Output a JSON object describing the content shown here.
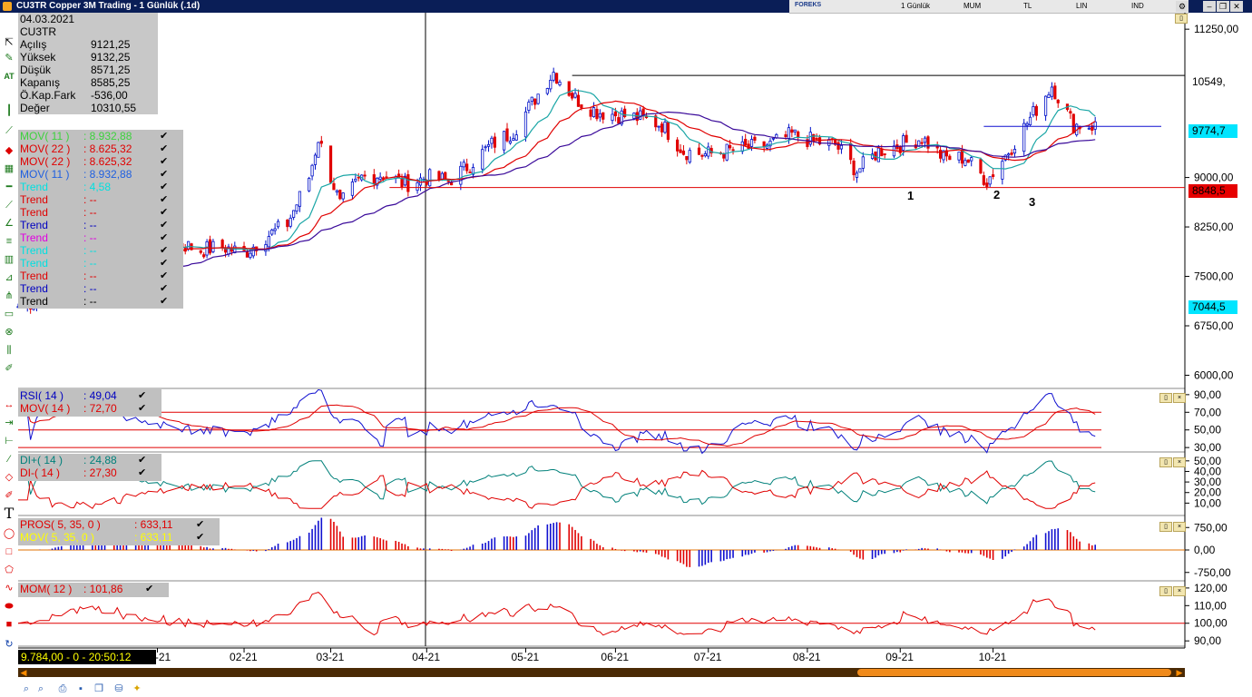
{
  "window": {
    "title": "CU3TR Copper 3M Trading - 1 Günlük (.1d)",
    "brand": "FOREKS",
    "options": [
      "1 Günlük",
      "MUM",
      "TL",
      "LIN",
      "IND"
    ]
  },
  "info": {
    "date": "04.03.2021",
    "symbol": "CU3TR",
    "rows": [
      {
        "label": "Açılış",
        "value": "9121,25"
      },
      {
        "label": "Yüksek",
        "value": "9132,25"
      },
      {
        "label": "Düşük",
        "value": "8571,25"
      },
      {
        "label": "Kapanış",
        "value": "8585,25"
      },
      {
        "label": "Ö.Kap.Fark",
        "value": "-536,00"
      },
      {
        "label": "Değer",
        "value": "10310,55"
      }
    ]
  },
  "price_legend": [
    {
      "name": "MOV( 11 )",
      "value": ": 8.932,88",
      "color": "#3cd23c"
    },
    {
      "name": "MOV( 22 )",
      "value": ": 8.625,32",
      "color": "#e00000"
    },
    {
      "name": "MOV( 22 )",
      "value": ": 8.625,32",
      "color": "#e00000"
    },
    {
      "name": "MOV( 11 )",
      "value": ": 8.932,88",
      "color": "#2060e0"
    },
    {
      "name": "Trend",
      "value": ": 4,58",
      "color": "#00e0e0"
    },
    {
      "name": "Trend",
      "value": ": --",
      "color": "#e00000"
    },
    {
      "name": "Trend",
      "value": ": --",
      "color": "#e00000"
    },
    {
      "name": "Trend",
      "value": ": --",
      "color": "#0000c0"
    },
    {
      "name": "Trend",
      "value": ": --",
      "color": "#e000e0"
    },
    {
      "name": "Trend",
      "value": ": --",
      "color": "#00e0e0"
    },
    {
      "name": "Trend",
      "value": ": --",
      "color": "#00e0e0"
    },
    {
      "name": "Trend",
      "value": ": --",
      "color": "#e00000"
    },
    {
      "name": "Trend",
      "value": ": --",
      "color": "#0000c0"
    },
    {
      "name": "Trend",
      "value": ": --",
      "color": "#000000"
    }
  ],
  "rsi_legend": [
    {
      "name": "RSI( 14 )",
      "value": ": 49,04",
      "color": "#0000c0"
    },
    {
      "name": "MOV( 14 )",
      "value": ": 72,70",
      "color": "#e00000"
    }
  ],
  "di_legend": [
    {
      "name": "DI+( 14 )",
      "value": ": 24,88",
      "color": "#00807a"
    },
    {
      "name": "DI-( 14 )",
      "value": ": 27,30",
      "color": "#e00000"
    }
  ],
  "pros_legend": [
    {
      "name": "PROS( 5, 35, 0 )",
      "value": ": 633,11",
      "color": "#e00000"
    },
    {
      "name": "MOV( 5, 35, 0 )",
      "value": ": 633,11",
      "color": "#ffff00"
    }
  ],
  "mom_legend": [
    {
      "name": "MOM( 12 )",
      "value": ": 101,86",
      "color": "#e00000"
    }
  ],
  "price_labels": [
    {
      "text": "10549,",
      "bg": "#ffffff",
      "fg": "#000000"
    },
    {
      "text": "9774,7",
      "bg": "#00e5ff",
      "fg": "#000000"
    },
    {
      "text": "8848,5",
      "bg": "#e60000",
      "fg": "#000000"
    },
    {
      "text": "7044,5",
      "bg": "#00e5ff",
      "fg": "#000000"
    }
  ],
  "pattern_marks": [
    "1",
    "2",
    "3"
  ],
  "status": "9.784,00 - 0 - 20:50:12",
  "chart_data": [
    {
      "type": "candlestick",
      "title": "CU3TR Copper 3M Trading - 1 Günlük (.1d)",
      "x_ticks": [
        "01-21",
        "02-21",
        "03-21",
        "04-21",
        "05-21",
        "06-21",
        "07-21",
        "08-21",
        "09-21",
        "10-21"
      ],
      "y_ticks": [
        "11250,00",
        "10500,00",
        "9750,00",
        "9000,00",
        "8250,00",
        "7500,00",
        "6750,00",
        "6000,00"
      ],
      "ylim": [
        5800,
        11500
      ],
      "horizontal_levels": [
        10549,
        9774.7,
        8848.5
      ],
      "close_path": [
        [
          "2020-11-20",
          7044
        ],
        [
          "2020-11-27",
          7150
        ],
        [
          "2020-12-04",
          7400
        ],
        [
          "2020-12-11",
          7700
        ],
        [
          "2020-12-18",
          7850
        ],
        [
          "2020-12-25",
          7900
        ],
        [
          "2021-01-04",
          7950
        ],
        [
          "2021-01-11",
          8000
        ],
        [
          "2021-01-18",
          7900
        ],
        [
          "2021-01-25",
          7950
        ],
        [
          "2021-02-01",
          7850
        ],
        [
          "2021-02-08",
          8100
        ],
        [
          "2021-02-15",
          8300
        ],
        [
          "2021-02-22",
          9000
        ],
        [
          "2021-02-25",
          9600
        ],
        [
          "2021-03-04",
          8585
        ],
        [
          "2021-03-11",
          9000
        ],
        [
          "2021-03-18",
          9050
        ],
        [
          "2021-03-25",
          8900
        ],
        [
          "2021-04-01",
          9000
        ],
        [
          "2021-04-08",
          8950
        ],
        [
          "2021-04-15",
          9200
        ],
        [
          "2021-04-22",
          9500
        ],
        [
          "2021-04-29",
          9700
        ],
        [
          "2021-05-06",
          10200
        ],
        [
          "2021-05-12",
          10600
        ],
        [
          "2021-05-19",
          10200
        ],
        [
          "2021-05-26",
          10000
        ],
        [
          "2021-06-02",
          9950
        ],
        [
          "2021-06-09",
          9900
        ],
        [
          "2021-06-16",
          9800
        ],
        [
          "2021-06-23",
          9400
        ],
        [
          "2021-06-30",
          9350
        ],
        [
          "2021-07-07",
          9400
        ],
        [
          "2021-07-14",
          9450
        ],
        [
          "2021-07-21",
          9500
        ],
        [
          "2021-07-28",
          9650
        ],
        [
          "2021-08-04",
          9550
        ],
        [
          "2021-08-11",
          9500
        ],
        [
          "2021-08-18",
          9100
        ],
        [
          "2021-08-25",
          9400
        ],
        [
          "2021-09-01",
          9500
        ],
        [
          "2021-09-08",
          9600
        ],
        [
          "2021-09-15",
          9300
        ],
        [
          "2021-09-22",
          9300
        ],
        [
          "2021-09-29",
          8950
        ],
        [
          "2021-10-06",
          9400
        ],
        [
          "2021-10-13",
          9900
        ],
        [
          "2021-10-20",
          10400
        ],
        [
          "2021-10-27",
          9800
        ],
        [
          "2021-11-03",
          9784
        ]
      ]
    },
    {
      "type": "line",
      "title": "RSI( 14 )",
      "y_ticks": [
        "90,00",
        "70,00",
        "50,00",
        "30,00"
      ],
      "ylim": [
        25,
        95
      ],
      "levels": [
        70,
        50,
        30
      ]
    },
    {
      "type": "line",
      "title": "DI+( 14 ) / DI-( 14 )",
      "y_ticks": [
        "50,00",
        "40,00",
        "30,00",
        "20,00",
        "10,00"
      ],
      "ylim": [
        0,
        55
      ]
    },
    {
      "type": "bar",
      "title": "PROS( 5, 35, 0 )",
      "y_ticks": [
        "750,00",
        "0,00",
        "-750,00"
      ],
      "ylim": [
        -1000,
        1000
      ]
    },
    {
      "type": "line",
      "title": "MOM( 12 )",
      "y_ticks": [
        "120,00",
        "110,00",
        "100,00",
        "90,00"
      ],
      "ylim": [
        87,
        122
      ],
      "levels": [
        100
      ]
    }
  ]
}
